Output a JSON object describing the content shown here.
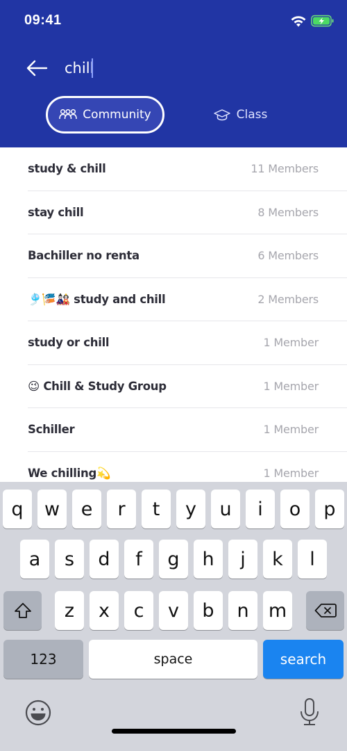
{
  "status_bar": {
    "time": "09:41",
    "wifi_icon": "wifi-icon",
    "battery_icon": "battery-charging-icon"
  },
  "colors": {
    "header_bg": "#2135a4",
    "search_key": "#1a84f0",
    "member_count": "#a6a6ad"
  },
  "search": {
    "back_icon": "arrow-left-icon",
    "value": "chill",
    "placeholder": ""
  },
  "tabs": [
    {
      "label": "Community",
      "icon": "people-group-icon",
      "active": true
    },
    {
      "label": "Class",
      "icon": "graduation-cap-icon",
      "active": false
    }
  ],
  "results": [
    {
      "name": "study & chill",
      "members": "11 Members"
    },
    {
      "name": "stay chill",
      "members": "8 Members"
    },
    {
      "name": "Bachiller no renta",
      "members": "6 Members"
    },
    {
      "name": "🎐🎏🎎 study and chill",
      "members": "2 Members"
    },
    {
      "name": "study or chill",
      "members": "1 Member"
    },
    {
      "name": "😉 Chill & Study Group",
      "members": "1 Member"
    },
    {
      "name": "Schiller",
      "members": "1 Member"
    },
    {
      "name": "We chilling💫",
      "members": "1 Member"
    }
  ],
  "keyboard": {
    "row1": [
      "q",
      "w",
      "e",
      "r",
      "t",
      "y",
      "u",
      "i",
      "o",
      "p"
    ],
    "row2": [
      "a",
      "s",
      "d",
      "f",
      "g",
      "h",
      "j",
      "k",
      "l"
    ],
    "row3": [
      "z",
      "x",
      "c",
      "v",
      "b",
      "n",
      "m"
    ],
    "numbers_label": "123",
    "space_label": "space",
    "action_label": "search",
    "shift_icon": "shift-icon",
    "delete_icon": "backspace-icon",
    "emoji_icon": "emoji-icon",
    "mic_icon": "microphone-icon"
  }
}
